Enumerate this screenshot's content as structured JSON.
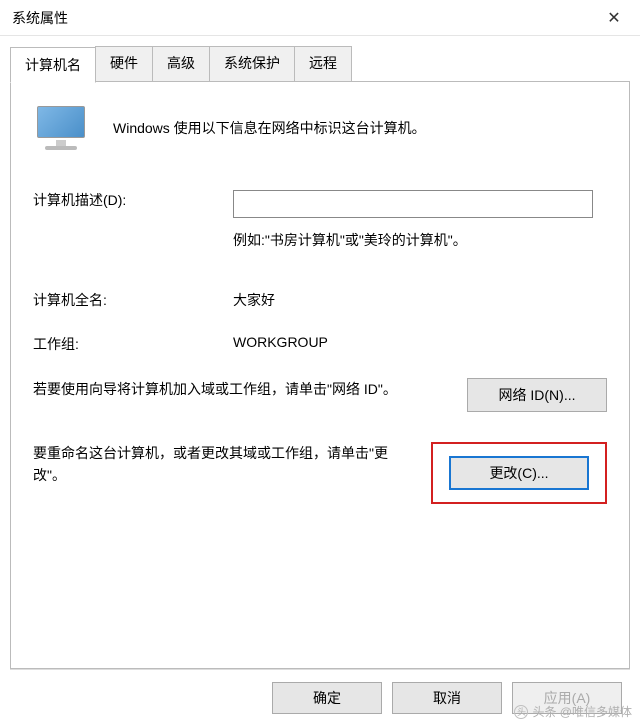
{
  "window": {
    "title": "系统属性"
  },
  "tabs": {
    "computer_name": "计算机名",
    "hardware": "硬件",
    "advanced": "高级",
    "system_protection": "系统保护",
    "remote": "远程"
  },
  "intro": "Windows 使用以下信息在网络中标识这台计算机。",
  "fields": {
    "description_label": "计算机描述(D):",
    "description_value": "",
    "example_text": "例如:\"书房计算机\"或\"美玲的计算机\"。",
    "full_name_label": "计算机全名:",
    "full_name_value": "大家好",
    "workgroup_label": "工作组:",
    "workgroup_value": "WORKGROUP"
  },
  "actions": {
    "network_id_text": "若要使用向导将计算机加入域或工作组，请单击\"网络 ID\"。",
    "network_id_button": "网络 ID(N)...",
    "change_text": "要重命名这台计算机，或者更改其域或工作组，请单击\"更改\"。",
    "change_button": "更改(C)..."
  },
  "footer": {
    "ok": "确定",
    "cancel": "取消",
    "apply": "应用(A)"
  },
  "watermark": "头条 @唯信多媒体"
}
